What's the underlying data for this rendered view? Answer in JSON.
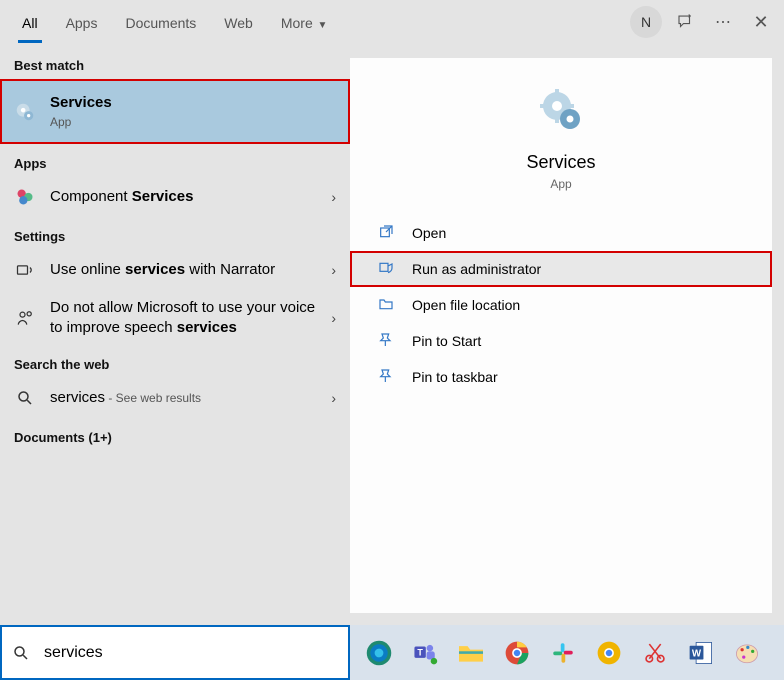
{
  "tabs": {
    "all": "All",
    "apps": "Apps",
    "documents": "Documents",
    "web": "Web",
    "more": "More"
  },
  "user_initial": "N",
  "sections": {
    "best_match": "Best match",
    "apps": "Apps",
    "settings": "Settings",
    "search_web": "Search the web",
    "documents": "Documents (1+)"
  },
  "best": {
    "title": "Services",
    "sub": "App"
  },
  "apps_results": {
    "component_pre": "Component ",
    "component_bold": "Services"
  },
  "settings_results": {
    "r1_pre": "Use online ",
    "r1_bold": "services",
    "r1_post": " with Narrator",
    "r2_pre": "Do not allow Microsoft to use your voice to improve speech ",
    "r2_bold": "services"
  },
  "web_results": {
    "query": "services",
    "suffix": " - See web results"
  },
  "hero": {
    "title": "Services",
    "sub": "App"
  },
  "actions": {
    "open": "Open",
    "run_admin": "Run as administrator",
    "open_loc": "Open file location",
    "pin_start": "Pin to Start",
    "pin_taskbar": "Pin to taskbar"
  },
  "search_value": "services"
}
